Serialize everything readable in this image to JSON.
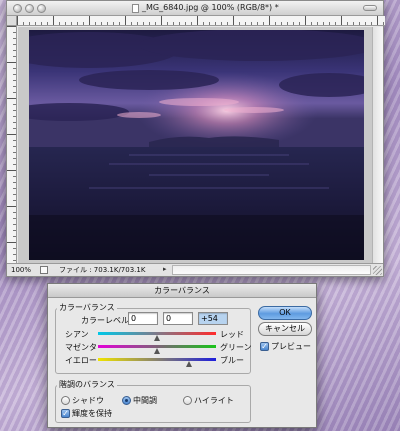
{
  "document": {
    "title": "_MG_6840.jpg @ 100% (RGB/8*) *",
    "zoom": "100%",
    "file_info": "ファイル : 703.1K/703.1K"
  },
  "dialog": {
    "title": "カラーバランス",
    "color_balance_group": "カラーバランス",
    "color_levels_label": "カラーレベル :",
    "levels": [
      "0",
      "0",
      "+54"
    ],
    "sliders": [
      {
        "left": "シアン",
        "right": "レッド",
        "value": 0
      },
      {
        "left": "マゼンタ",
        "right": "グリーン",
        "value": 0
      },
      {
        "left": "イエロー",
        "right": "ブルー",
        "value": 54
      }
    ],
    "tone_group": "階調のバランス",
    "tones": [
      "シャドウ",
      "中間調",
      "ハイライト"
    ],
    "selected_tone": "中間調",
    "preserve_luminosity": "輝度を保持",
    "ok_label": "OK",
    "cancel_label": "キャンセル",
    "preview_label": "プレビュー"
  },
  "colors": {
    "sky_top": "#2a2452",
    "sunset": "#f4b4c8",
    "water": "#1c1a3c"
  }
}
